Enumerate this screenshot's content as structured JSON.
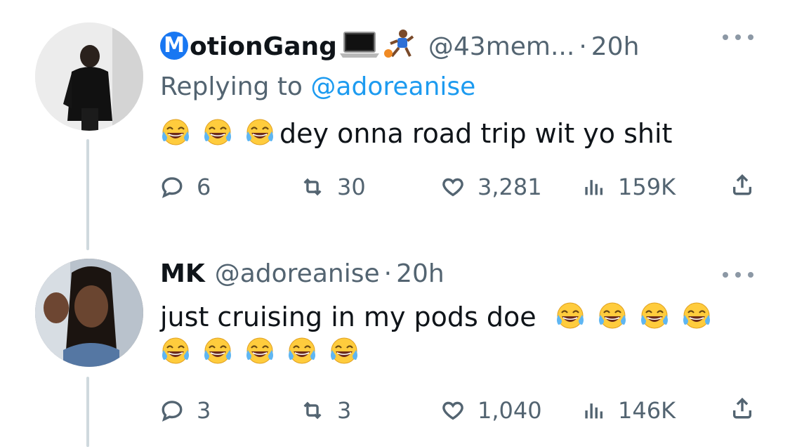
{
  "tweets": [
    {
      "display_name": "otionGang",
      "display_name_badge_letter": "M",
      "name_emojis": [
        "laptop",
        "basketball-player"
      ],
      "handle": "@43mem...",
      "time": "20h",
      "replying_prefix": "Replying to",
      "replying_to": "@adoreanise",
      "text": "dey onna road trip wit yo shit",
      "leading_emojis": [
        "face-with-tears-of-joy",
        "face-with-tears-of-joy",
        "face-with-tears-of-joy"
      ],
      "metrics": {
        "replies": "6",
        "retweets": "30",
        "likes": "3,281",
        "views": "159K"
      }
    },
    {
      "display_name": "MK",
      "handle": "@adoreanise",
      "time": "20h",
      "text": "just cruising in my pods doe",
      "trailing_emojis": [
        "face-with-tears-of-joy",
        "face-with-tears-of-joy",
        "face-with-tears-of-joy",
        "face-with-tears-of-joy",
        "face-with-tears-of-joy",
        "face-with-tears-of-joy",
        "face-with-tears-of-joy",
        "face-with-tears-of-joy",
        "face-with-tears-of-joy"
      ],
      "metrics": {
        "replies": "3",
        "retweets": "3",
        "likes": "1,040",
        "views": "146K"
      }
    }
  ],
  "colors": {
    "link": "#1d9bf0",
    "muted": "#536471",
    "text": "#0f1419",
    "badge": "#1877f2",
    "thread_line": "#cfd9de"
  }
}
